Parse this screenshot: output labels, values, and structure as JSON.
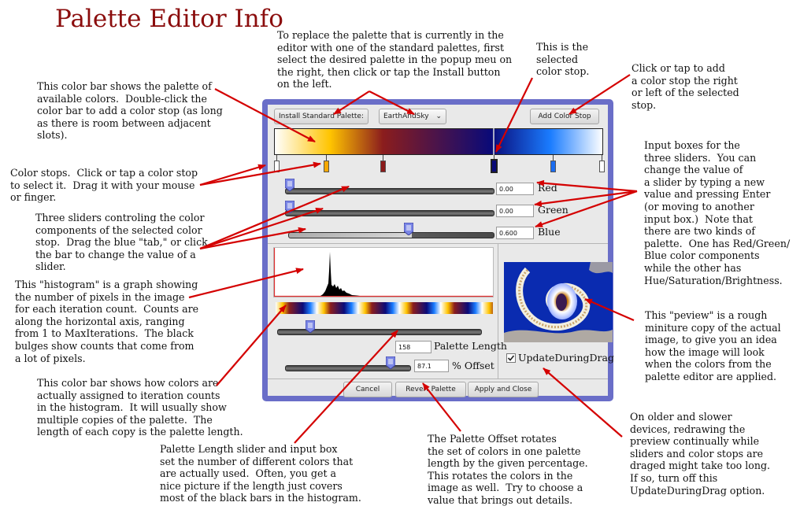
{
  "title": "Palette Editor Info",
  "annotations": {
    "replace_palette": "To replace the palette that is currently in the\neditor with one of the standard palettes, first\nselect the desired palette in the popup meu on\nthe right, then click or tap the Install button\non the left.",
    "selected_stop": "This is the\nselected\ncolor stop.",
    "add_stop": "Click or tap to add\na color stop the right\nor left of the selected\nstop.",
    "color_bar": "This color bar shows the palette of\navailable colors.  Double-click the\ncolor bar to add a color stop (as long\nas there is room between adjacent\nslots).",
    "color_stops": "Color stops.  Click or tap a color stop\nto select it.  Drag it with your mouse\nor finger.",
    "sliders": "Three sliders controling the color\ncomponents of the selected color\nstop.  Drag the blue \"tab,\" or click\nthe bar to change the value of a\nslider.",
    "histogram": "This \"histogram\" is a graph showing\nthe number of pixels in the image\nfor each iteration count.  Counts are\nalong the horizontal axis, ranging\nfrom 1 to MaxIterations.  The black\nbulges show counts that come from\na lot of pixels.",
    "assigned_bar": "This color bar shows how colors are\nactually assigned to iteration counts\nin the histogram.  It will usually show\nmultiple copies of the palette.  The\nlength of each copy is the palette length.",
    "input_boxes": "Input boxes for the\nthree sliders.  You can\nchange the value of\na slider by typing a new\nvalue and pressing Enter\n(or moving to another\ninput box.)  Note that\nthere are two kinds of\npalette.  One has Red/Green/\nBlue color components\nwhile the other has\nHue/Saturation/Brightness.",
    "preview": "This \"peview\" is a rough\nminiture copy of the actual\nimage, to give you an idea\nhow the image will look\nwhen the colors from the\npalette editor are applied.",
    "update_drag": "On older and slower\ndevices, redrawing the\npreview continually while\nsliders and color stops are\ndraged might take too long.\nIf so, turn off this\nUpdateDuringDrag option.",
    "palette_length": "Palette Length slider and input box\nset the number of different colors that\nare actually used.  Often, you get a\nnice picture if the length just covers\nmost of the black bars in the histogram.",
    "palette_offset": "The Palette Offset rotates\nthe set of colors in one palette\nlength by the given percentage.\nThis rotates the colors in the\nimage as well.  Try to choose a\nvalue that brings out details."
  },
  "dialog": {
    "install_label": "Install Standard Palette:",
    "palette_select": "EarthAndSky",
    "add_stop_label": "Add Color Stop",
    "sliders": [
      {
        "label": "Red",
        "value": "0.00",
        "fraction": 0.0
      },
      {
        "label": "Green",
        "value": "0.00",
        "fraction": 0.0
      },
      {
        "label": "Blue",
        "value": "0.600",
        "fraction": 0.6
      }
    ],
    "length": {
      "label": "Palette Length",
      "value": "158"
    },
    "offset": {
      "label": "% Offset",
      "value": "87.1",
      "percent": 87.1
    },
    "update_label": "UpdateDuringDrag",
    "update_checked": true,
    "cancel_label": "Cancel",
    "revert_label": "Revert Palette",
    "apply_label": "Apply and Close"
  },
  "colors": {
    "arrow": "#d40000",
    "title": "#8b0d0d",
    "dialog_frame": "#6a6ec8",
    "slider_thumb": "#7a86e6"
  }
}
